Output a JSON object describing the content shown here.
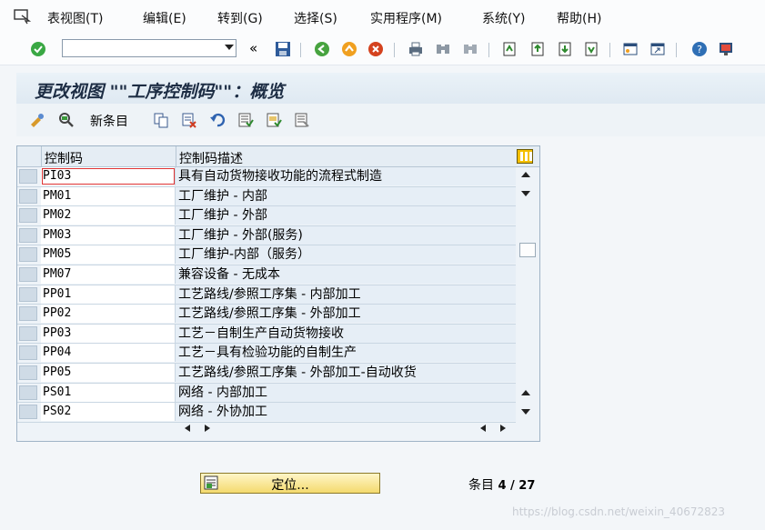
{
  "menu": {
    "items": [
      {
        "label": "表视图(T)",
        "key": "T"
      },
      {
        "label": "编辑(E)",
        "key": "E"
      },
      {
        "label": "转到(G)",
        "key": "G"
      },
      {
        "label": "选择(S)",
        "key": "S"
      },
      {
        "label": "实用程序(M)",
        "key": "M"
      },
      {
        "label": "系统(Y)",
        "key": "Y"
      },
      {
        "label": "帮助(H)",
        "key": "H"
      }
    ]
  },
  "toolbar": {
    "command_field_value": "",
    "icons": [
      "enter-check-icon",
      "command-dropdown",
      "collapse-icon",
      "save-icon",
      "back-icon",
      "exit-icon",
      "cancel-icon",
      "print-icon",
      "find-icon",
      "find-next-icon",
      "first-page-icon",
      "previous-page-icon",
      "next-page-icon",
      "last-page-icon",
      "create-session-icon",
      "shortcut-icon",
      "help-icon",
      "customize-layout-icon"
    ],
    "collapse_label": "«"
  },
  "title": "更改视图 \"\"工序控制码\"\"：概览",
  "app_toolbar": {
    "new_entries_label": "新条目",
    "icons": [
      "change-display-icon",
      "details-icon",
      "copy-icon",
      "delete-icon",
      "undo-icon",
      "select-all-icon",
      "select-block-icon",
      "deselect-all-icon"
    ]
  },
  "table": {
    "columns": [
      "控制码",
      "控制码描述"
    ],
    "rows": [
      {
        "code": "PI03",
        "desc": "具有自动货物接收功能的流程式制造"
      },
      {
        "code": "PM01",
        "desc": "工厂维护 - 内部"
      },
      {
        "code": "PM02",
        "desc": "工厂维护 - 外部"
      },
      {
        "code": "PM03",
        "desc": "工厂维护 - 外部(服务)"
      },
      {
        "code": "PM05",
        "desc": "工厂维护-内部（服务）"
      },
      {
        "code": "PM07",
        "desc": "兼容设备 - 无成本"
      },
      {
        "code": "PP01",
        "desc": "工艺路线/参照工序集 - 内部加工"
      },
      {
        "code": "PP02",
        "desc": "工艺路线/参照工序集 - 外部加工"
      },
      {
        "code": "PP03",
        "desc": "工艺－自制生产自动货物接收"
      },
      {
        "code": "PP04",
        "desc": "工艺－具有检验功能的自制生产"
      },
      {
        "code": "PP05",
        "desc": "工艺路线/参照工序集 - 外部加工-自动收货"
      },
      {
        "code": "PS01",
        "desc": "网络 - 内部加工"
      },
      {
        "code": "PS02",
        "desc": "网络 - 外协加工"
      }
    ]
  },
  "position_button_label": "定位...",
  "entries": {
    "label": "条目",
    "value": "4 / 27"
  },
  "watermark": "https://blog.csdn.net/weixin_40672823",
  "colors": {
    "accent_yellow": "#f4da6e",
    "title_bg": "#dfe9f2",
    "desc_cell": "#e6eef6"
  }
}
